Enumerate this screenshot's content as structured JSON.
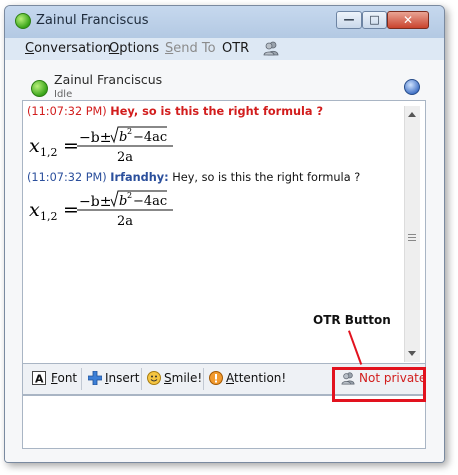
{
  "window": {
    "title": "Zainul Franciscus"
  },
  "menu": {
    "items": [
      {
        "key": "conversation",
        "label": "Conversation",
        "underline": "C",
        "enabled": true
      },
      {
        "key": "options",
        "label": "Options",
        "underline": "O",
        "enabled": true
      },
      {
        "key": "send_to",
        "label": "Send To",
        "underline": "S",
        "enabled": false
      },
      {
        "key": "otr",
        "label": "OTR",
        "enabled": true
      }
    ],
    "otr_icon": "people-icon"
  },
  "contact": {
    "name": "Zainul Franciscus",
    "status": "Idle",
    "status_color": "#3aa51a"
  },
  "messages": [
    {
      "time": "(11:07:32 PM)",
      "sender": "",
      "text": "Hey, so is this the right formula ?",
      "type": "received",
      "formula": "x_{1,2} = (-b ± √(b²-4ac)) / 2a"
    },
    {
      "time": "(11:07:32 PM)",
      "sender": "Irfandhy:",
      "text": "Hey, so is this the right formula ?",
      "type": "sent",
      "formula": "x_{1,2} = (-b ± √(b²-4ac)) / 2a"
    }
  ],
  "toolbar": {
    "font": "Font",
    "insert": "Insert",
    "smile": "Smile!",
    "attention": "Attention!",
    "otr_status": "Not private"
  },
  "annotation": {
    "label": "OTR Button",
    "color": "#e2121e"
  }
}
